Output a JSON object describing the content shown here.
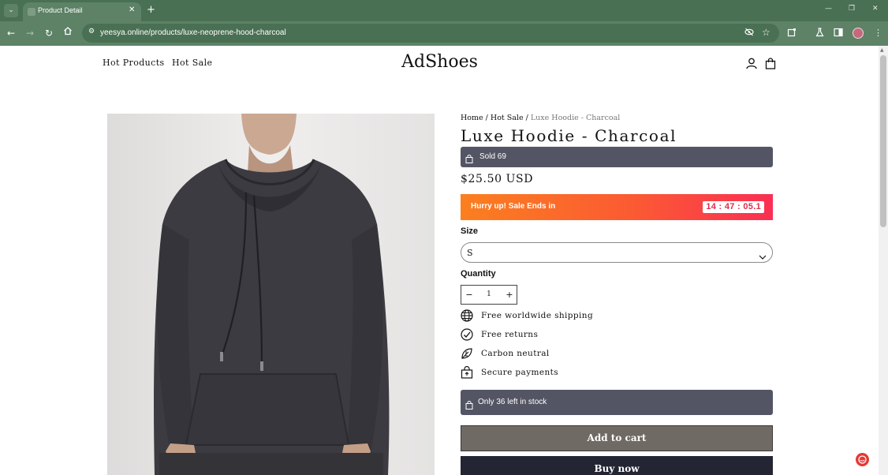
{
  "browser": {
    "tab_title": "Product Detail",
    "tab_close": "✕",
    "new_tab": "+",
    "url": "yeesya.online/products/luxe-neoprene-hood-charcoal",
    "theme_color": "#4a7054"
  },
  "store": {
    "nav": [
      "Hot Products",
      "Hot Sale"
    ],
    "logo": "AdShoes"
  },
  "product": {
    "breadcrumb": {
      "home": "Home",
      "separator": "/",
      "category": "Hot Sale",
      "current": "Luxe Hoodie - Charcoal"
    },
    "title": "Luxe Hoodie - Charcoal",
    "sold": "Sold 69",
    "price": "$25.50 USD",
    "sale_banner": {
      "text": "Hurry up! Sale Ends in",
      "countdown": "14 : 47 : 05.1"
    },
    "size": {
      "label": "Size",
      "selected": "S"
    },
    "quantity": {
      "label": "Quantity",
      "value": "1",
      "minus": "−",
      "plus": "+"
    },
    "features": [
      {
        "icon": "globe-icon",
        "text": "Free worldwide shipping"
      },
      {
        "icon": "check-circle-icon",
        "text": "Free returns"
      },
      {
        "icon": "leaf-icon",
        "text": "Carbon neutral"
      },
      {
        "icon": "lock-icon",
        "text": "Secure payments"
      }
    ],
    "stock": "Only 36 left in stock",
    "add_to_cart": "Add to cart",
    "buy_now": "Buy now"
  },
  "colors": {
    "info_bar": "#545564",
    "sale_start": "#fb7f1f",
    "sale_end": "#fa2f54",
    "add_to_cart": "#6f6a63",
    "buy_now": "#232533",
    "hoodie": "#3a3a40"
  }
}
